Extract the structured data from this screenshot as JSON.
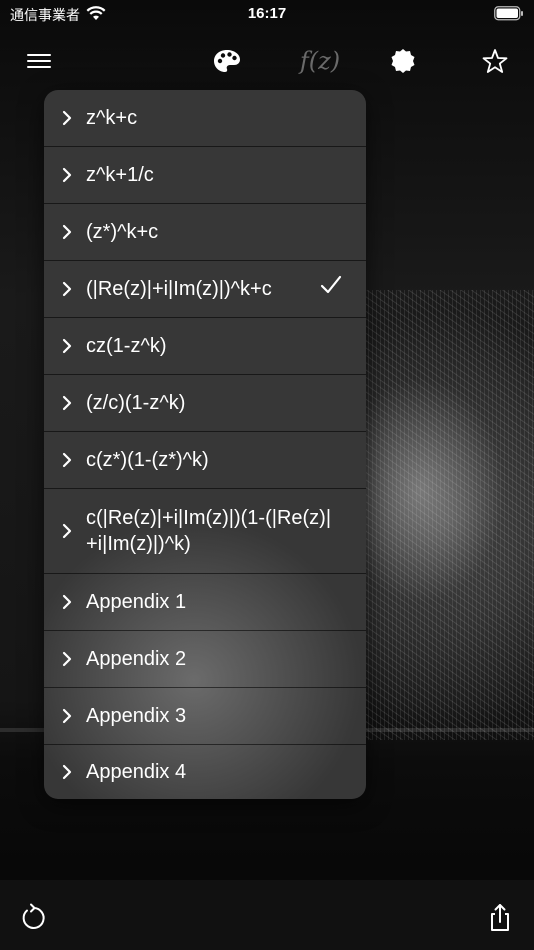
{
  "status_bar": {
    "carrier": "通信事業者",
    "time": "16:17",
    "wifi_icon": "wifi-icon",
    "battery_icon": "battery-icon"
  },
  "toolbar": {
    "menu_icon": "hamburger-menu-icon",
    "palette_icon": "palette-icon",
    "function_label": "f(z)",
    "badge_icon": "seal-badge-icon",
    "favorite_icon": "star-icon"
  },
  "formula_menu": {
    "items": [
      {
        "label": "z^k+c"
      },
      {
        "label": "z^k+1/c"
      },
      {
        "label": "(z*)^k+c"
      },
      {
        "label": "(|Re(z)|+i|Im(z)|)^k+c",
        "selected": true
      },
      {
        "label": "cz(1-z^k)"
      },
      {
        "label": "(z/c)(1-z^k)"
      },
      {
        "label": "c(z*)(1-(z*)^k)"
      },
      {
        "label": "c(|Re(z)|+i|Im(z)|)(1-(|Re(z)|+i|Im(z)|)^k)"
      },
      {
        "label": "Appendix 1"
      },
      {
        "label": "Appendix 2"
      },
      {
        "label": "Appendix 3"
      },
      {
        "label": "Appendix 4"
      }
    ]
  },
  "bottom_bar": {
    "reset_icon": "refresh-icon",
    "share_icon": "share-icon"
  }
}
